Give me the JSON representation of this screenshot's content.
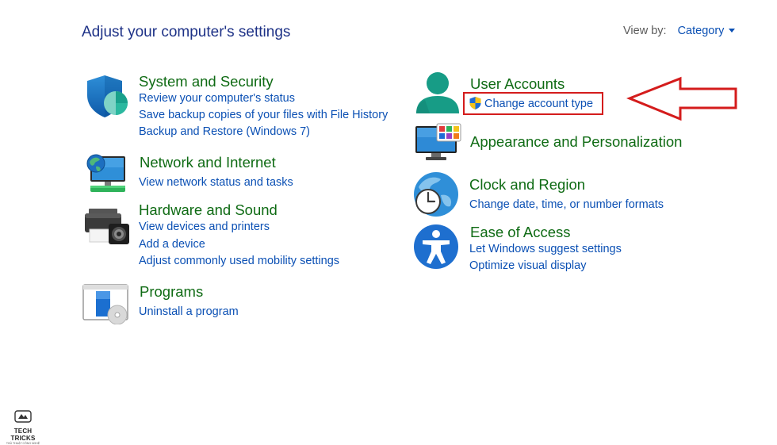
{
  "header": {
    "title": "Adjust your computer's settings",
    "view_by_label": "View by:",
    "view_by_value": "Category"
  },
  "categories": [
    {
      "title": "System and Security",
      "icon": "shield-icon",
      "links": [
        "Review your computer's status",
        "Save backup copies of your files with File History",
        "Backup and Restore (Windows 7)"
      ]
    },
    {
      "title": "Network and Internet",
      "icon": "network-globe-icon",
      "links": [
        "View network status and tasks"
      ]
    },
    {
      "title": "Hardware and Sound",
      "icon": "printer-icon",
      "links": [
        "View devices and printers",
        "Add a device",
        "Adjust commonly used mobility settings"
      ]
    },
    {
      "title": "Programs",
      "icon": "programs-icon",
      "links": [
        "Uninstall a program"
      ]
    },
    {
      "title": "User Accounts",
      "icon": "user-icon",
      "links": [
        "Change account type"
      ]
    },
    {
      "title": "Appearance and Personalization",
      "icon": "monitor-palette-icon",
      "links": []
    },
    {
      "title": "Clock and Region",
      "icon": "clock-globe-icon",
      "links": [
        "Change date, time, or number formats"
      ]
    },
    {
      "title": "Ease of Access",
      "icon": "accessibility-icon",
      "links": [
        "Let Windows suggest settings",
        "Optimize visual display"
      ]
    }
  ],
  "annotation": {
    "box_color": "#d41c1c",
    "arrow_color": "#d41c1c"
  },
  "colors": {
    "heading_blue": "#1e3287",
    "category_green": "#0f6b14",
    "link_blue": "#0b50b4"
  },
  "watermark": {
    "name": "TECH TRICKS",
    "tagline": "THỦ THUẬT CÔNG NGHỆ"
  }
}
